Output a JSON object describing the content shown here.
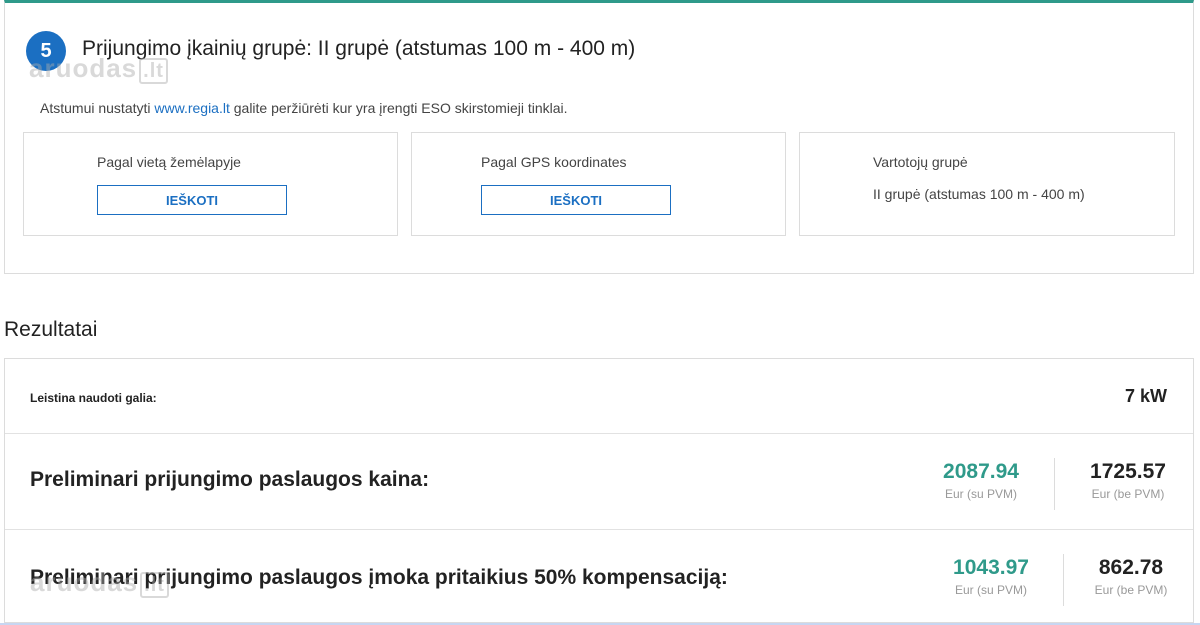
{
  "step": {
    "number": "5",
    "title": "Prijungimo įkainių grupė: II grupė (atstumas 100 m - 400 m)",
    "hint_before": "Atstumui nustatyti",
    "hint_link": "www.regia.lt",
    "hint_after": "galite peržiūrėti kur yra įrengti ESO skirstomieji tinklai.",
    "options": [
      {
        "label": "Pagal vietą žemėlapyje",
        "button": "IEŠKOTI"
      },
      {
        "label": "Pagal GPS koordinates",
        "button": "IEŠKOTI"
      },
      {
        "label": "Vartotojų grupė",
        "value": "II grupė (atstumas 100 m - 400 m)"
      }
    ]
  },
  "watermark": {
    "text": "aruodas",
    "suffix": ".lt"
  },
  "results": {
    "heading": "Rezultatai",
    "power_label": "Leistina naudoti galia:",
    "power_value": "7 kW",
    "price_label": "Preliminari prijungimo paslaugos kaina:",
    "price_with_vat": "2087.94",
    "price_with_vat_caption": "Eur (su PVM)",
    "price_without_vat": "1725.57",
    "price_without_vat_caption": "Eur (be PVM)",
    "comp_label": "Preliminari prijungimo paslaugos įmoka pritaikius 50% kompensaciją:",
    "comp_with_vat": "1043.97",
    "comp_with_vat_caption": "Eur (su PVM)",
    "comp_without_vat": "862.78",
    "comp_without_vat_caption": "Eur (be PVM)"
  },
  "colors": {
    "accent_blue": "#1b6fc2",
    "accent_teal": "#2f9a8a"
  }
}
